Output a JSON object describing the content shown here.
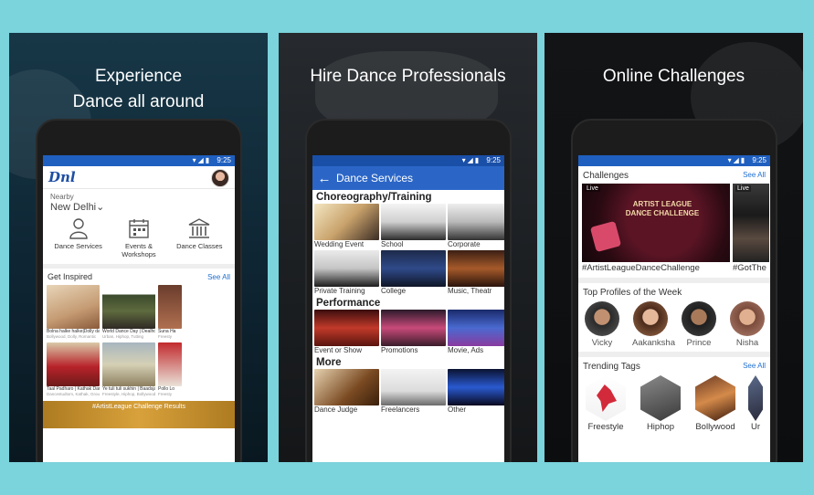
{
  "panel1": {
    "headline_line1": "Experience",
    "headline_line2": "Dance all around",
    "status_time": "9:25",
    "logo": "Dnl",
    "location_label": "Nearby",
    "location_city": "New Delhi",
    "quick_links": [
      {
        "label": "Dance Services",
        "icon": "person-icon"
      },
      {
        "label": "Events &\nWorkshops",
        "icon": "calendar-icon"
      },
      {
        "label": "Dance Classes",
        "icon": "building-icon"
      }
    ],
    "get_inspired": {
      "title": "Get Inspired",
      "see_all": "See All",
      "row1": [
        {
          "caption": "Bolna halke halke|Dolly dance",
          "sub": "Bollywood, Dolly, Romantic"
        },
        {
          "caption": "World Dance Day | Dealhoppers",
          "sub": "Urban, Hiphop, Tutting"
        },
        {
          "caption": "Suna Ha",
          "sub": "Freesty"
        }
      ],
      "row2": [
        {
          "caption": "Taal Padharo | Kathak Dance",
          "sub": "Dancestudtom, Kathak, Group"
        },
        {
          "caption": "Ye tuli tuli sukhin | Baadsjar",
          "sub": "Freestyle, Hiphop, Bollywood"
        },
        {
          "caption": "Pollo Lo",
          "sub": "Freesty"
        }
      ],
      "banner": "#ArtistLeague Challenge Results"
    }
  },
  "panel2": {
    "headline": "Hire Dance Professionals",
    "status_time": "9:25",
    "toolbar_title": "Dance Services",
    "sections": [
      {
        "title": "Choreography/Training",
        "rows": [
          [
            "Wedding Event",
            "School",
            "Corporate"
          ],
          [
            "Private Training",
            "College",
            "Music, Theatr"
          ]
        ]
      },
      {
        "title": "Performance",
        "rows": [
          [
            "Event or Show",
            "Promotions",
            "Movie, Ads"
          ]
        ]
      },
      {
        "title": "More",
        "rows": [
          [
            "Dance Judge",
            "Freelancers",
            "Other"
          ]
        ]
      }
    ]
  },
  "panel3": {
    "headline": "Online Challenges",
    "status_time": "9:25",
    "challenges_title": "Challenges",
    "see_all": "See All",
    "challenges": [
      {
        "badge": "Live",
        "caption": "#ArtistLeagueDanceChallenge",
        "poster_line1": "ARTIST LEAGUE",
        "poster_line2": "DANCE CHALLENGE"
      },
      {
        "badge": "Live",
        "caption": "#GotThe"
      }
    ],
    "profiles_title": "Top Profiles of the Week",
    "profiles": [
      "Vicky",
      "Aakanksha",
      "Prince",
      "Nisha"
    ],
    "tags_title": "Trending Tags",
    "tags_see_all": "See All",
    "tags": [
      "Freestyle",
      "Hiphop",
      "Bollywood",
      "Ur"
    ]
  },
  "colors": {
    "background": "#7bd3dc",
    "accent_blue": "#2b66c7",
    "link_blue": "#1f6fd1"
  }
}
